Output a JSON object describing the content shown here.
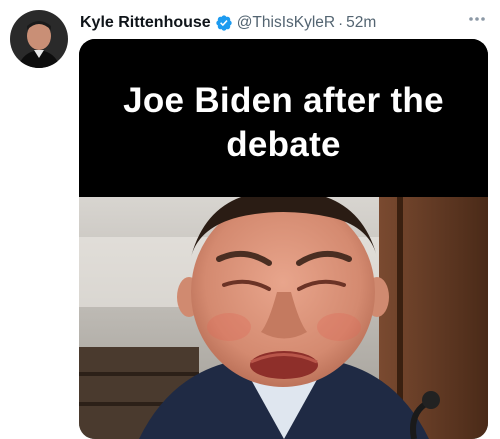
{
  "tweet": {
    "author": {
      "display_name": "Kyle Rittenhouse",
      "handle": "@ThisIsKyleR",
      "verified": true,
      "avatar_icon": "profile-photo"
    },
    "separator": "·",
    "timestamp": "52m",
    "more_icon": "ellipsis-icon",
    "media": {
      "caption": "Joe Biden after the debate",
      "photo_subject": "crying-man-in-suit"
    }
  },
  "colors": {
    "verified_badge": "#1d9bf0",
    "secondary_text": "#536471",
    "primary_text": "#0f1419"
  }
}
